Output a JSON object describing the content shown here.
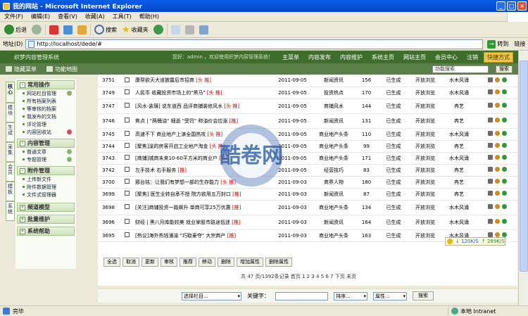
{
  "window": {
    "title": "我的网站 - Microsoft Internet Explorer"
  },
  "menubar": {
    "items": [
      "文件(F)",
      "编辑(E)",
      "查看(V)",
      "收藏(A)",
      "工具(T)",
      "帮助(H)"
    ]
  },
  "toolbar": {
    "back": "后退",
    "search": "搜索",
    "favorites": "收藏夹"
  },
  "address": {
    "label": "地址(D)",
    "url": "http://localhost/dede/#",
    "go": "转到",
    "links": "链接"
  },
  "app": {
    "brand": "织梦内容管理系统",
    "welcome": "您好：admin ，欢迎使用织梦内容管理系统！",
    "nav": [
      "主菜单",
      "内容发布",
      "内容维护",
      "系统主页",
      "网站主页",
      "会员中心",
      "注销"
    ],
    "quick": "快捷方式",
    "hide_menu": "隐藏菜单",
    "func_map": "功能地图",
    "func_search_placeholder": "功能搜索",
    "func_search_btn": "搜索"
  },
  "vtabs": [
    "核心",
    "模块",
    "生成",
    "采集",
    "会员",
    "模板",
    "系统"
  ],
  "sidebar": {
    "groups": [
      {
        "title": "常用操作",
        "items": [
          "网站栏目管理",
          "所有档案列表",
          "等审核的档案",
          "我发布的文档",
          "评论管理",
          "内容回收站"
        ]
      },
      {
        "title": "内容管理",
        "items": [
          "普通文章",
          "专题管理"
        ]
      },
      {
        "title": "附件管理",
        "items": [
          "上传新文件",
          "附件数据管理",
          "文件式管理器"
        ]
      },
      {
        "title": "频道模型",
        "items": []
      },
      {
        "title": "批量维护",
        "items": []
      },
      {
        "title": "系统帮助",
        "items": []
      }
    ]
  },
  "table": {
    "rows": [
      {
        "id": "3751",
        "title": "康帮欲天大道披露后市招商",
        "flags": "[头 推]",
        "date": "2011-09-05",
        "cat": "新闻资讯",
        "clicks": "156",
        "status": "已生成",
        "access": "开放浏览",
        "author": "水木风涌"
      },
      {
        "id": "3749",
        "title": "人民币 收藏投资市场上的\"黑马\"",
        "flags": "[头 推]",
        "date": "2011-09-05",
        "cat": "投资热点",
        "clicks": "170",
        "status": "已生成",
        "access": "开放浏览",
        "author": "水木风涌"
      },
      {
        "id": "3747",
        "title": "[风水·装璜] 说东道西 品评商铺装修风水",
        "flags": "[头 推]",
        "date": "2011-09-05",
        "cat": "商铺风水",
        "clicks": "144",
        "status": "已生成",
        "access": "开放浏览",
        "author": "冉艺"
      },
      {
        "id": "3746",
        "title": "焦点 | \"两桶油\" 细逝 \"受罚\" 称油价会应涨",
        "flags": "[推]",
        "date": "2011-09-05",
        "cat": "新闻资讯",
        "clicks": "131",
        "status": "已生成",
        "access": "开放浏览",
        "author": "冉艺"
      },
      {
        "id": "3745",
        "title": "高速不下 商业地产上演全国热攻",
        "flags": "[头 推]",
        "date": "2011-09-05",
        "cat": "商业地产头条",
        "clicks": "110",
        "status": "已生成",
        "access": "开放浏览",
        "author": "水木风涌"
      },
      {
        "id": "3744",
        "title": "[聚焦]渝的房客开启工业地产淘金",
        "flags": "[头 推]",
        "date": "2011-09-05",
        "cat": "商业地产头条",
        "clicks": "99",
        "status": "已生成",
        "access": "开放浏览",
        "author": "冉艺"
      },
      {
        "id": "3743",
        "title": "[商铺]城商未来10-60平方米的商业户",
        "flags": "[推]",
        "date": "2011-09-05",
        "cat": "商业地产头条",
        "clicks": "171",
        "status": "已生成",
        "access": "开放浏览",
        "author": "水木风涌"
      },
      {
        "id": "3742",
        "title": "左手技术 右手服务",
        "flags": "[推]",
        "date": "2011-09-05",
        "cat": "经营技巧",
        "clicks": "83",
        "status": "已生成",
        "access": "开放浏览",
        "author": "冉艺"
      },
      {
        "id": "3700",
        "title": "那台铭：让我们有梦想一部的生存能力",
        "flags": "[头 推]",
        "date": "2011-09-03",
        "cat": "商界人物",
        "clicks": "180",
        "status": "已生成",
        "access": "开放浏览",
        "author": "冉艺"
      },
      {
        "id": "3699",
        "title": "[聚焦] 医生业转自承不授 院方欲用五万封口",
        "flags": "[推]",
        "date": "2011-09-03",
        "cat": "新闻资讯",
        "clicks": "87",
        "status": "已生成",
        "access": "开放浏览",
        "author": "冉艺"
      },
      {
        "id": "3698",
        "title": "[关注]商铺投资一路飙升 单商可享25万优惠",
        "flags": "[推]",
        "date": "2011-09-03",
        "cat": "商业地产头条",
        "clicks": "134",
        "status": "已生成",
        "access": "开放浏览",
        "author": "水木风涌"
      },
      {
        "id": "3696",
        "title": "财经 | 黑八月库能较美 就业掌股市路途低迷",
        "flags": "[推]",
        "date": "2011-09-03",
        "cat": "新闻资讯",
        "clicks": "164",
        "status": "已生成",
        "access": "开放浏览",
        "author": "水木风涌"
      },
      {
        "id": "3695",
        "title": "[热议]海外热钱涌渝 \"巧取豪夺\" 大宗商产",
        "flags": "[推]",
        "date": "2011-09-03",
        "cat": "商业地产头条",
        "clicks": "163",
        "status": "已生成",
        "access": "开放浏览",
        "author": "水木风涌"
      }
    ]
  },
  "actions": [
    "全选",
    "取消",
    "更新",
    "审核",
    "推荐",
    "移动",
    "删除",
    "增加属性",
    "删除属性"
  ],
  "pager": "共 47 页/1392条记录 首页 1 2 3 4 5 6 7 下页 末页",
  "bottom_search": {
    "column": "选择栏目...",
    "keyword_label": "关键字：",
    "sort": "排序...",
    "attr": "属性...",
    "button": "搜索"
  },
  "speed": {
    "down": "120K/S",
    "up": "289K/S"
  },
  "watermark": {
    "text": "酷卷网"
  },
  "status": {
    "left": "完毕",
    "zone": "本地 Intranet"
  }
}
